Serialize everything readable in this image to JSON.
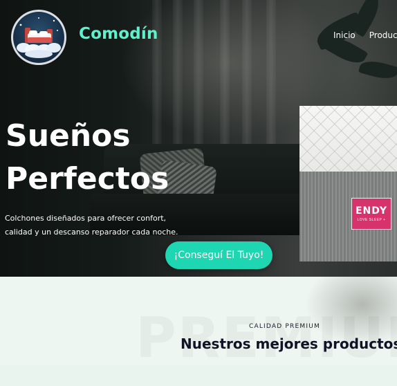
{
  "header": {
    "brand": "Comodín",
    "nav": [
      "Inicio",
      "Producto"
    ]
  },
  "hero": {
    "title_line1": "Sueños",
    "title_line2": "Perfectos",
    "description": "Colchones diseñados para ofrecer confort, calidad y un descanso reparador cada noche.",
    "cta_label": "¡Conseguí El Tuyo!",
    "product_tag": {
      "name": "ENDY",
      "tagline": "LOVE SLEEP +"
    }
  },
  "products_section": {
    "watermark": "PREMIUM",
    "eyebrow": "CALIDAD PREMIUM",
    "title": "Nuestros mejores productos"
  },
  "colors": {
    "accent": "#1fd6b3",
    "brand_text": "#5ff0cc",
    "section_bg": "#eef6f1",
    "tag": "#d6336c"
  },
  "icons": [
    "bed-logo-icon"
  ]
}
